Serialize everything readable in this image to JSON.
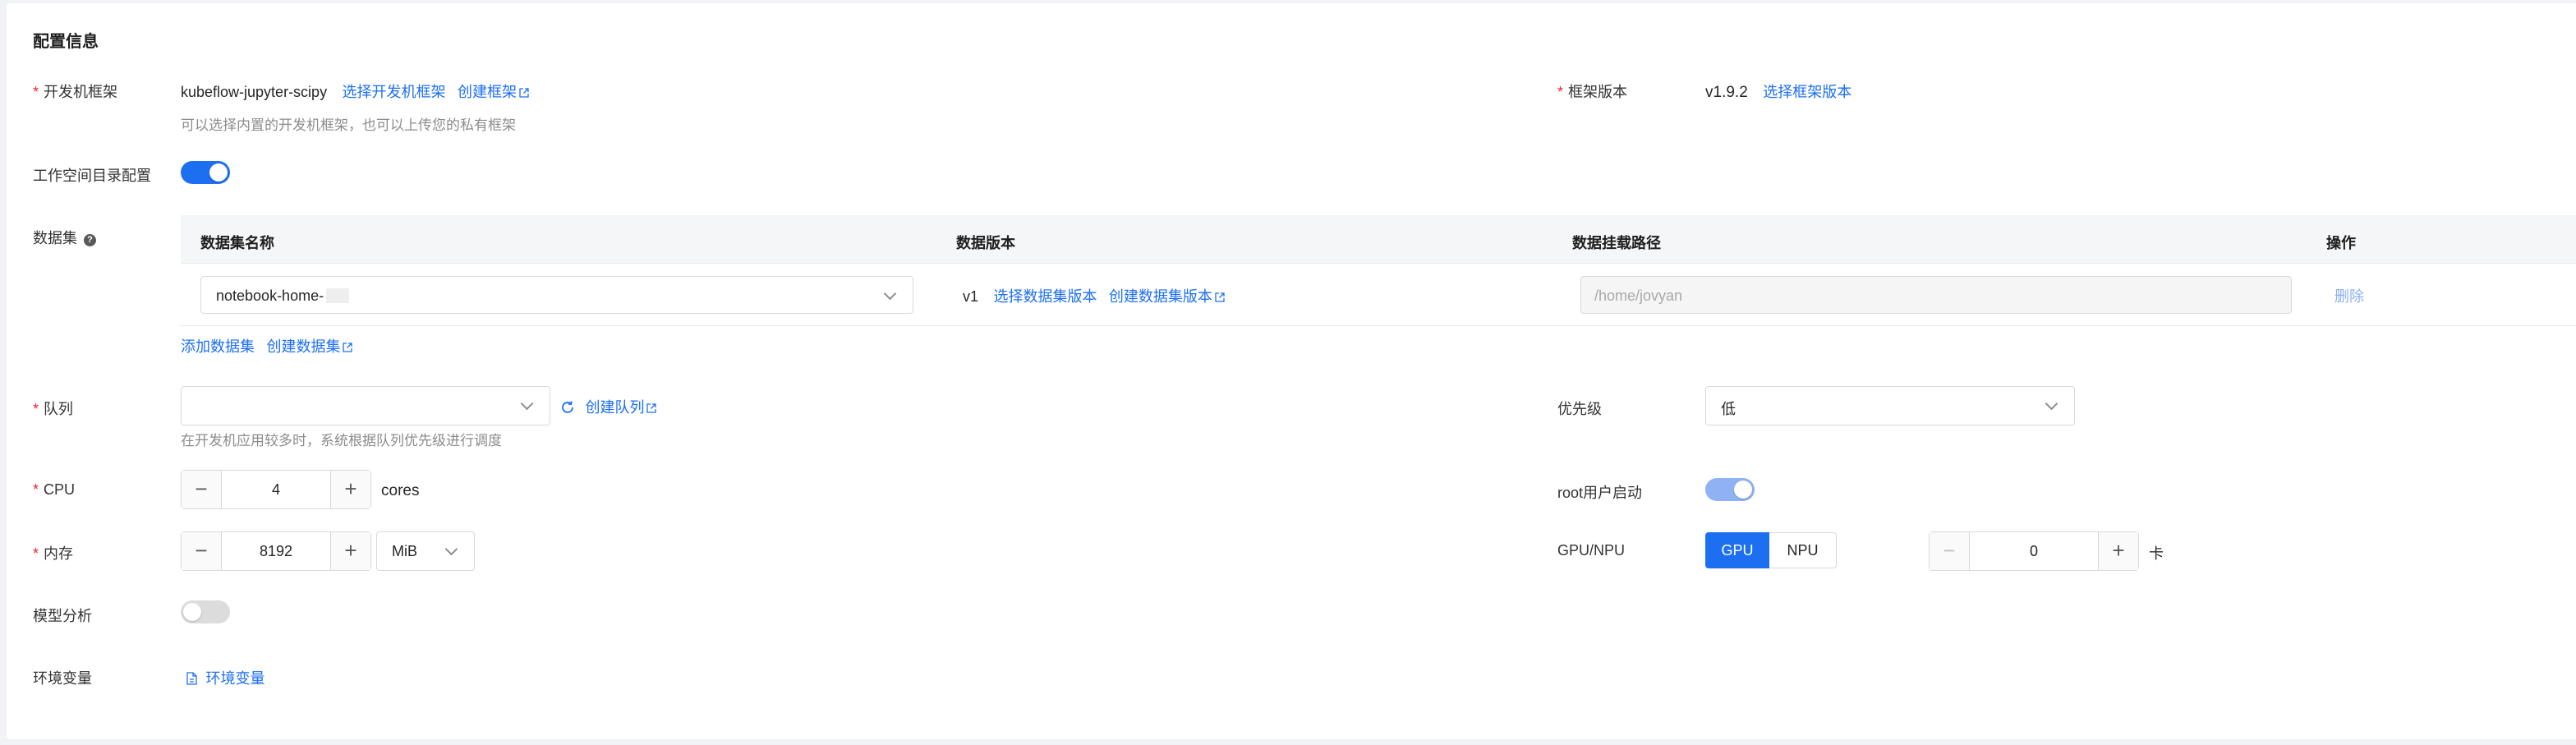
{
  "section_title": "配置信息",
  "framework": {
    "label": "开发机框架",
    "value": "kubeflow-jupyter-scipy",
    "select_link": "选择开发机框架",
    "create_link": "创建框架",
    "hint": "可以选择内置的开发机框架，也可以上传您的私有框架"
  },
  "framework_version": {
    "label": "框架版本",
    "value": "v1.9.2",
    "select_link": "选择框架版本"
  },
  "workspace": {
    "label": "工作空间目录配置",
    "enabled": true
  },
  "dataset": {
    "label": "数据集",
    "help_icon": "question-circle-icon",
    "columns": [
      "数据集名称",
      "数据版本",
      "数据挂载路径",
      "操作"
    ],
    "rows": [
      {
        "name": "notebook-home-",
        "version": "v1",
        "select_version_link": "选择数据集版本",
        "create_version_link": "创建数据集版本",
        "mount_path_placeholder": "/home/jovyan",
        "delete_label": "删除"
      }
    ],
    "add_link": "添加数据集",
    "create_link": "创建数据集"
  },
  "queue": {
    "label": "队列",
    "value": "",
    "refresh_icon": "refresh-icon",
    "create_link": "创建队列",
    "hint": "在开发机应用较多时，系统根据队列优先级进行调度"
  },
  "priority": {
    "label": "优先级",
    "value": "低"
  },
  "cpu": {
    "label": "CPU",
    "value": "4",
    "unit": "cores"
  },
  "root_start": {
    "label": "root用户启动",
    "enabled": true
  },
  "memory": {
    "label": "内存",
    "value": "8192",
    "unit": "MiB"
  },
  "gpu": {
    "label": "GPU/NPU",
    "options": [
      "GPU",
      "NPU"
    ],
    "selected": "GPU",
    "value": "0",
    "unit": "卡"
  },
  "model_analysis": {
    "label": "模型分析",
    "enabled": false
  },
  "env_vars": {
    "label": "环境变量",
    "link": "环境变量",
    "icon": "file-icon"
  },
  "colors": {
    "primary": "#1d6ff2",
    "required": "#f5222d"
  }
}
